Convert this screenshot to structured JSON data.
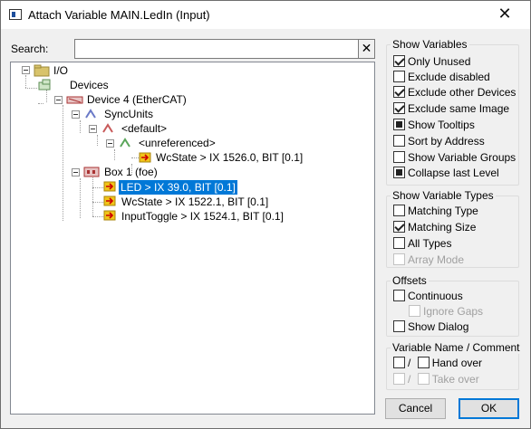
{
  "window": {
    "title": "Attach Variable MAIN.LedIn (Input)",
    "icon": "app-window-icon",
    "close": "✕"
  },
  "search": {
    "label": "Search:",
    "value": "",
    "clear": "✕"
  },
  "tree": {
    "nodes": [
      {
        "label": "I/O",
        "icon": "io-folder-icon",
        "expander": "minus"
      },
      {
        "label": "Devices",
        "icon": "devices-icon"
      },
      {
        "label": "Device 4 (EtherCAT)",
        "icon": "ethercat-device-icon",
        "expander": "minus"
      },
      {
        "label": "SyncUnits",
        "icon": "sync-units-icon",
        "expander": "minus"
      },
      {
        "label": "<default>",
        "icon": "sync-unit-icon",
        "expander": "minus"
      },
      {
        "label": "<unreferenced>",
        "icon": "sync-unit-icon",
        "expander": "minus"
      },
      {
        "label": "WcState   >   IX 1526.0, BIT [0.1]",
        "icon": "input-variable-icon"
      },
      {
        "label": "Box 1 (foe)",
        "icon": "box-icon",
        "expander": "minus"
      },
      {
        "label": "LED   >   IX 39.0, BIT [0.1]",
        "icon": "input-variable-icon",
        "selected": true
      },
      {
        "label": "WcState   >   IX 1522.1, BIT [0.1]",
        "icon": "input-variable-icon"
      },
      {
        "label": "InputToggle   >   IX 1524.1, BIT [0.1]",
        "icon": "input-variable-icon"
      }
    ]
  },
  "show_variables": {
    "title": "Show Variables",
    "items": [
      {
        "label": "Only Unused",
        "state": "checked"
      },
      {
        "label": "Exclude disabled",
        "state": "unchecked"
      },
      {
        "label": "Exclude other Devices",
        "state": "checked"
      },
      {
        "label": "Exclude same Image",
        "state": "checked"
      },
      {
        "label": "Show Tooltips",
        "state": "filled"
      },
      {
        "label": "Sort by Address",
        "state": "unchecked"
      },
      {
        "label": "Show Variable Groups",
        "state": "unchecked"
      },
      {
        "label": "Collapse last Level",
        "state": "filled"
      }
    ]
  },
  "show_variable_types": {
    "title": "Show Variable Types",
    "items": [
      {
        "label": "Matching Type",
        "state": "unchecked"
      },
      {
        "label": "Matching Size",
        "state": "checked"
      },
      {
        "label": "All Types",
        "state": "unchecked"
      },
      {
        "label": "Array Mode",
        "state": "disabled"
      }
    ]
  },
  "offsets": {
    "title": "Offsets",
    "items": [
      {
        "label": "Continuous",
        "state": "unchecked"
      },
      {
        "label": "Ignore Gaps",
        "state": "disabled"
      },
      {
        "label": "Show Dialog",
        "state": "unchecked"
      }
    ]
  },
  "variable_name": {
    "title": "Variable Name / Comment",
    "slash": "/",
    "hand_over": "Hand over",
    "take_over": "Take over"
  },
  "buttons": {
    "cancel": "Cancel",
    "ok": "OK"
  },
  "colors": {
    "selection": "#0078d7",
    "ok_border": "#0078d7",
    "dialog_bg": "#f0f0f0"
  }
}
